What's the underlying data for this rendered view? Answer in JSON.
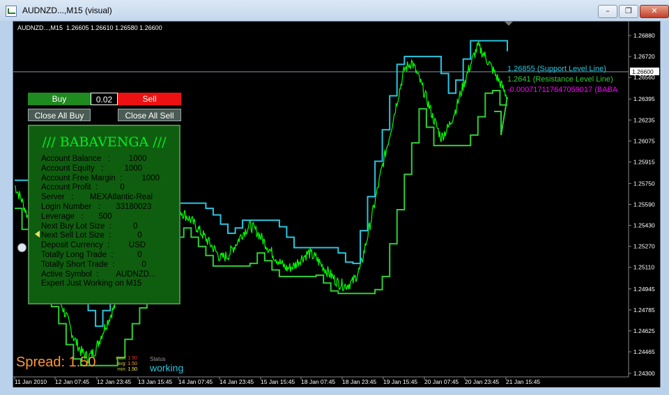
{
  "window": {
    "title": "AUDNZD...,M15 (visual)",
    "buttons": [
      "minimize",
      "restore",
      "close"
    ]
  },
  "chart_header": {
    "symbol": "AUDNZD...,M15",
    "ohlc": "1.26605 1.26610 1.26580 1.26600"
  },
  "price_axis": {
    "ticks": [
      "1.26880",
      "1.26720",
      "1.26560",
      "1.26395",
      "1.26235",
      "1.26075",
      "1.25915",
      "1.25750",
      "1.25590",
      "1.25430",
      "1.25270",
      "1.25110",
      "1.24945",
      "1.24785",
      "1.24625",
      "1.24465",
      "1.24300"
    ],
    "current_price": "1.26600"
  },
  "time_axis": {
    "ticks": [
      "11 Jan 2010",
      "12 Jan 07:45",
      "12 Jan 23:45",
      "13 Jan 15:45",
      "14 Jan 07:45",
      "14 Jan 23:45",
      "15 Jan 15:45",
      "18 Jan 07:45",
      "18 Jan 23:45",
      "19 Jan 15:45",
      "20 Jan 07:45",
      "20 Jan 23:45",
      "21 Jan 15:45"
    ]
  },
  "annotations": {
    "support": "1.26855 (Support Level Line)",
    "resistance": "1.2641 (Resistance Level Line)",
    "baba": "-0.000717117647059017 (BABA"
  },
  "trade_panel": {
    "buy_label": "Buy",
    "lot_value": "0.02",
    "sell_label": "Sell",
    "close_buy_label": "Close All Buy",
    "close_sell_label": "Close All Sell"
  },
  "info_panel": {
    "title": "/// BABAVENGA ///",
    "rows": [
      {
        "label": "Account Balance   :",
        "value": "1000"
      },
      {
        "label": "Account Equity   :",
        "value": "1000"
      },
      {
        "label": "Account Free Margin  :",
        "value": "1000"
      },
      {
        "label": "Account Profit  :",
        "value": "0"
      },
      {
        "label": "Server   :",
        "value": "MEXAtlantic-Real"
      },
      {
        "label": "Login Number   :",
        "value": "33180023"
      },
      {
        "label": "Leverage   :",
        "value": "500"
      },
      {
        "label": "Next Buy Lot Size  :",
        "value": "0"
      },
      {
        "label": "Next Sell Lot Size  :",
        "value": "0"
      },
      {
        "label": "Deposit Currency  :",
        "value": "USD"
      },
      {
        "label": "Totally Long Trade  :",
        "value": "0"
      },
      {
        "label": "Totally Short Trade  :",
        "value": "0"
      },
      {
        "label": "Active Symbol  :",
        "value": "AUDNZD..."
      },
      {
        "label": "Expert Just Working on M15",
        "value": ""
      }
    ]
  },
  "status": {
    "spread_label": "Spread: 1.50",
    "max_label": "max:",
    "max": "1.50",
    "avg_label": "avg:",
    "avg": "1.50",
    "min_label": "min:",
    "min": "1.50",
    "status_label": "Status",
    "status_value": "working"
  },
  "colors": {
    "price": "#00ff00",
    "support": "#29c6e0",
    "resistance": "#2fd035",
    "baba": "#ff00ff",
    "panel": "#0f5e0f"
  },
  "chart_data": {
    "type": "line",
    "series": [
      {
        "values": [
          1.25735,
          1.2562,
          1.2546,
          1.2533,
          1.2518,
          1.2502,
          1.2487,
          1.2474,
          1.2458,
          1.2447,
          1.2442,
          1.2448,
          1.2462,
          1.2474,
          1.2486,
          1.2498,
          1.2511,
          1.2522,
          1.2532,
          1.254,
          1.2548,
          1.2553,
          1.2556,
          1.2552,
          1.2547,
          1.254,
          1.2533,
          1.2526,
          1.2518,
          1.252,
          1.2528,
          1.2537,
          1.2543,
          1.2538,
          1.253,
          1.2522,
          1.2515,
          1.251,
          1.2512,
          1.2518,
          1.2522,
          1.2518,
          1.2511,
          1.2505,
          1.2499,
          1.2497,
          1.25,
          1.251,
          1.2535,
          1.2561,
          1.2588,
          1.2612,
          1.2638,
          1.2662,
          1.2668,
          1.2655,
          1.264,
          1.2624,
          1.261,
          1.2618,
          1.2632,
          1.265,
          1.2666,
          1.268,
          1.2672,
          1.2662,
          1.2652,
          1.2641
        ]
      },
      {
        "name": "Support Level Line",
        "values": [
          1.26855
        ]
      },
      {
        "name": "Resistance Level Line",
        "values": [
          1.2641
        ]
      }
    ]
  }
}
